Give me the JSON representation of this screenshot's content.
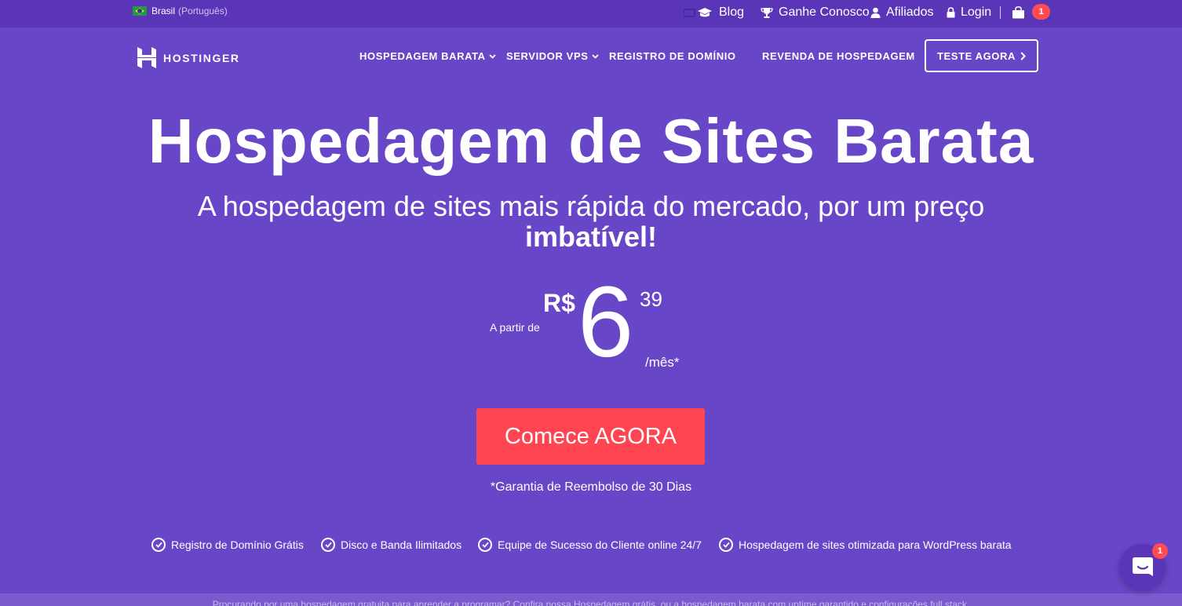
{
  "topbar": {
    "locale_country": "Brasil",
    "locale_language": "(Português)",
    "links": [
      {
        "label": "Blog",
        "icon": "graduation-cap-icon"
      },
      {
        "label": "Ganhe Conosco",
        "icon": "trophy-icon"
      },
      {
        "label": "Afiliados",
        "icon": "user-icon"
      },
      {
        "label": "Login",
        "icon": "lock-icon"
      }
    ],
    "cart_count": "1"
  },
  "nav": {
    "logo_text": "HOSTINGER",
    "items": [
      {
        "label": "HOSPEDAGEM BARATA",
        "has_dropdown": true
      },
      {
        "label": "SERVIDOR VPS",
        "has_dropdown": true
      },
      {
        "label": "REGISTRO DE DOMÍNIO",
        "has_dropdown": false
      },
      {
        "label": "REVENDA DE HOSPEDAGEM",
        "has_dropdown": false
      }
    ],
    "cta_label": "TESTE AGORA"
  },
  "hero": {
    "title": "Hospedagem de Sites Barata",
    "subtitle": "A hospedagem de sites mais rápida do mercado, por um preço",
    "subtitle_bold": "imbatível!",
    "price_prefix": "A partir de",
    "currency": "R$",
    "price_integer": "6",
    "price_cents": "39",
    "price_period": "/mês*",
    "cta_label": "Comece AGORA",
    "guarantee": "*Garantia de Reembolso de 30 Dias"
  },
  "features": [
    "Registro de Domínio Grátis",
    "Disco e Banda Ilimitados",
    "Equipe de Sucesso do Cliente online 24/7",
    "Hospedagem de sites otimizada para WordPress barata"
  ],
  "bottom_strip": {
    "text": "Procurando por uma hospedagem gratuita para aprender a programar? Confira nossa Hospedagem grátis, ou a hospedagem barata com uptime garantido e configurações full stack."
  },
  "chat": {
    "badge_count": "1"
  },
  "colors": {
    "background": "#6846c8",
    "topbar": "#5a35b7",
    "cta": "#ff4551",
    "badge": "#ff4c52"
  }
}
